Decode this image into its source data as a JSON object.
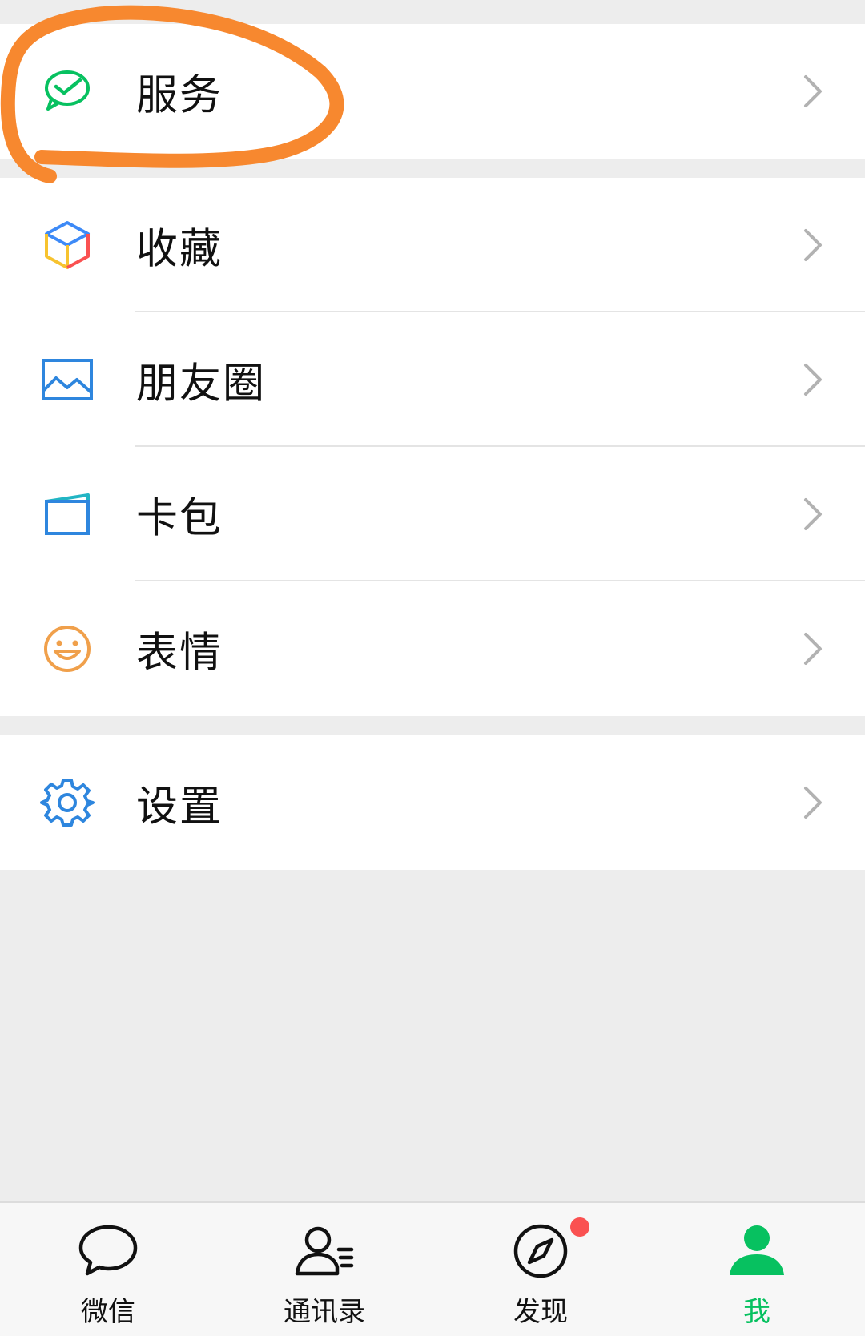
{
  "menu": {
    "service": {
      "label": "服务",
      "icon": "wechat-pay-check-icon"
    },
    "favorites": {
      "label": "收藏",
      "icon": "cube-icon"
    },
    "moments": {
      "label": "朋友圈",
      "icon": "photo-album-icon"
    },
    "cards": {
      "label": "卡包",
      "icon": "card-wallet-icon"
    },
    "stickers": {
      "label": "表情",
      "icon": "smile-face-icon"
    },
    "settings": {
      "label": "设置",
      "icon": "gear-icon"
    }
  },
  "tabbar": {
    "chats": {
      "label": "微信",
      "icon": "chat-bubble-icon"
    },
    "contacts": {
      "label": "通讯录",
      "icon": "contacts-icon"
    },
    "discover": {
      "label": "发现",
      "icon": "compass-icon",
      "has_badge": true
    },
    "me": {
      "label": "我",
      "icon": "person-icon",
      "active": true
    }
  },
  "colors": {
    "accent": "#07c160",
    "badge": "#fa5151",
    "annotation": "#f7882f",
    "background": "#ededed"
  }
}
